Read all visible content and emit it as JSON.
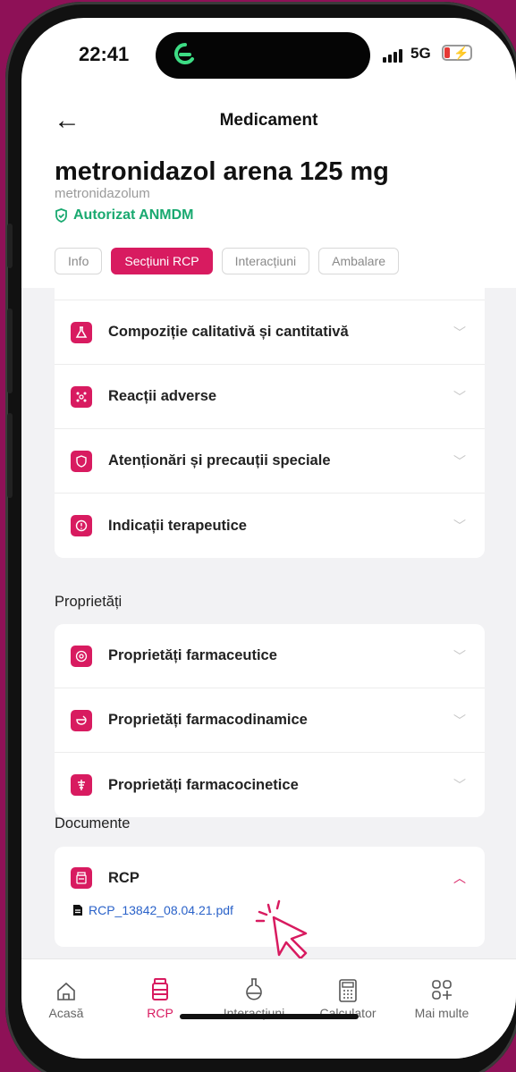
{
  "status": {
    "time": "22:41",
    "network": "5G"
  },
  "header": {
    "title": "Medicament"
  },
  "product": {
    "name": "metronidazol arena 125 mg",
    "substance": "metronidazolum",
    "authorization": "Autorizat ANMDM"
  },
  "tabs": [
    {
      "label": "Info",
      "active": false
    },
    {
      "label": "Secțiuni RCP",
      "active": true
    },
    {
      "label": "Interacțiuni",
      "active": false
    },
    {
      "label": "Ambalare",
      "active": false
    }
  ],
  "rcp_sections": [
    {
      "label": "Compoziție calitativă și cantitativă",
      "icon": "flask-icon"
    },
    {
      "label": "Reacții adverse",
      "icon": "molecule-icon"
    },
    {
      "label": "Atenționări și precauții speciale",
      "icon": "shield-icon"
    },
    {
      "label": "Indicații terapeutice",
      "icon": "info-circle-icon"
    }
  ],
  "properties": {
    "heading": "Proprietăți",
    "items": [
      {
        "label": "Proprietăți farmaceutice",
        "icon": "target-icon"
      },
      {
        "label": "Proprietăți farmacodinamice",
        "icon": "mortar-icon"
      },
      {
        "label": "Proprietăți farmacocinetice",
        "icon": "caduceus-icon"
      }
    ]
  },
  "documents": {
    "heading": "Documente",
    "item_label": "RCP",
    "file": "RCP_13842_08.04.21.pdf"
  },
  "nav": [
    {
      "label": "Acasă",
      "icon": "home-icon",
      "active": false
    },
    {
      "label": "RCP",
      "icon": "pill-bottle-icon",
      "active": true
    },
    {
      "label": "Interacțiuni",
      "icon": "flask-icon",
      "active": false
    },
    {
      "label": "Calculator",
      "icon": "calculator-icon",
      "active": false
    },
    {
      "label": "Mai multe",
      "icon": "grid-plus-icon",
      "active": false
    }
  ],
  "colors": {
    "accent": "#d81b60",
    "authorized": "#19a970",
    "background": "#8e1157",
    "link": "#2a62c9"
  }
}
